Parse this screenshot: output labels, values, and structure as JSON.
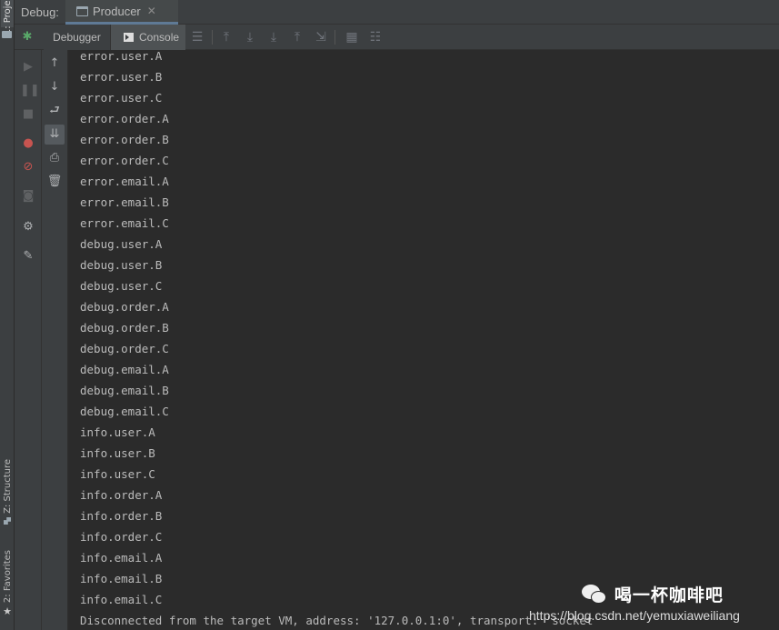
{
  "left_stripe": {
    "project_tab": "1: Project",
    "structure_tab": "Z: Structure",
    "favorites_tab": "2: Favorites"
  },
  "debug_bar": {
    "label": "Debug:",
    "session_tab": "Producer",
    "close_glyph": "✕"
  },
  "toolbar": {
    "debugger_tab": "Debugger",
    "console_tab": "Console"
  },
  "console": {
    "lines": [
      "error.user.A",
      "error.user.B",
      "error.user.C",
      "error.order.A",
      "error.order.B",
      "error.order.C",
      "error.email.A",
      "error.email.B",
      "error.email.C",
      "debug.user.A",
      "debug.user.B",
      "debug.user.C",
      "debug.order.A",
      "debug.order.B",
      "debug.order.C",
      "debug.email.A",
      "debug.email.B",
      "debug.email.C",
      "info.user.A",
      "info.user.B",
      "info.user.C",
      "info.order.A",
      "info.order.B",
      "info.order.C",
      "info.email.A",
      "info.email.B",
      "info.email.C"
    ],
    "status": "Disconnected from the target VM, address: '127.0.0.1:0', transport: 'socket'"
  },
  "watermark": {
    "title": "喝一杯咖啡吧",
    "url": "https://blog.csdn.net/yemuxiaweiliang"
  }
}
